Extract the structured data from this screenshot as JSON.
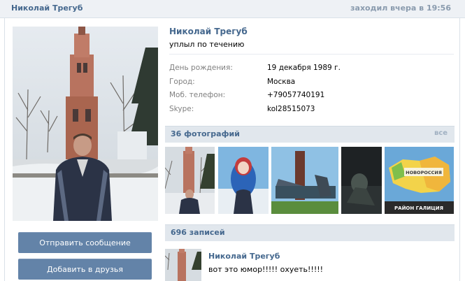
{
  "header": {
    "name": "Николай Трегуб",
    "last_seen": "заходил вчера в 19:56"
  },
  "profile": {
    "name": "Николай Трегуб",
    "status": "уплыл по течению",
    "info": [
      {
        "key": "День рождения:",
        "value": "19 декабря 1989 г."
      },
      {
        "key": "Город:",
        "value": "Москва"
      },
      {
        "key": "Моб. телефон:",
        "value": "+79057740191"
      },
      {
        "key": "Skype:",
        "value": "kol28515073"
      }
    ]
  },
  "actions": {
    "send_message": "Отправить сообщение",
    "add_friend": "Добавить в друзья"
  },
  "photos": {
    "title": "36 фотографий",
    "all_link": "все",
    "map_label": "НОВОРОССИЯ",
    "map_caption": "РАЙОН ГАЛИЦИЯ"
  },
  "wall": {
    "title": "696 записей",
    "post_author": "Николай Трегуб",
    "post_text": "вот это юмор!!!!! охуеть!!!!!"
  },
  "colors": {
    "link_blue": "#45688e",
    "button_blue": "#6383a8",
    "section_bg": "#e1e7ed"
  }
}
